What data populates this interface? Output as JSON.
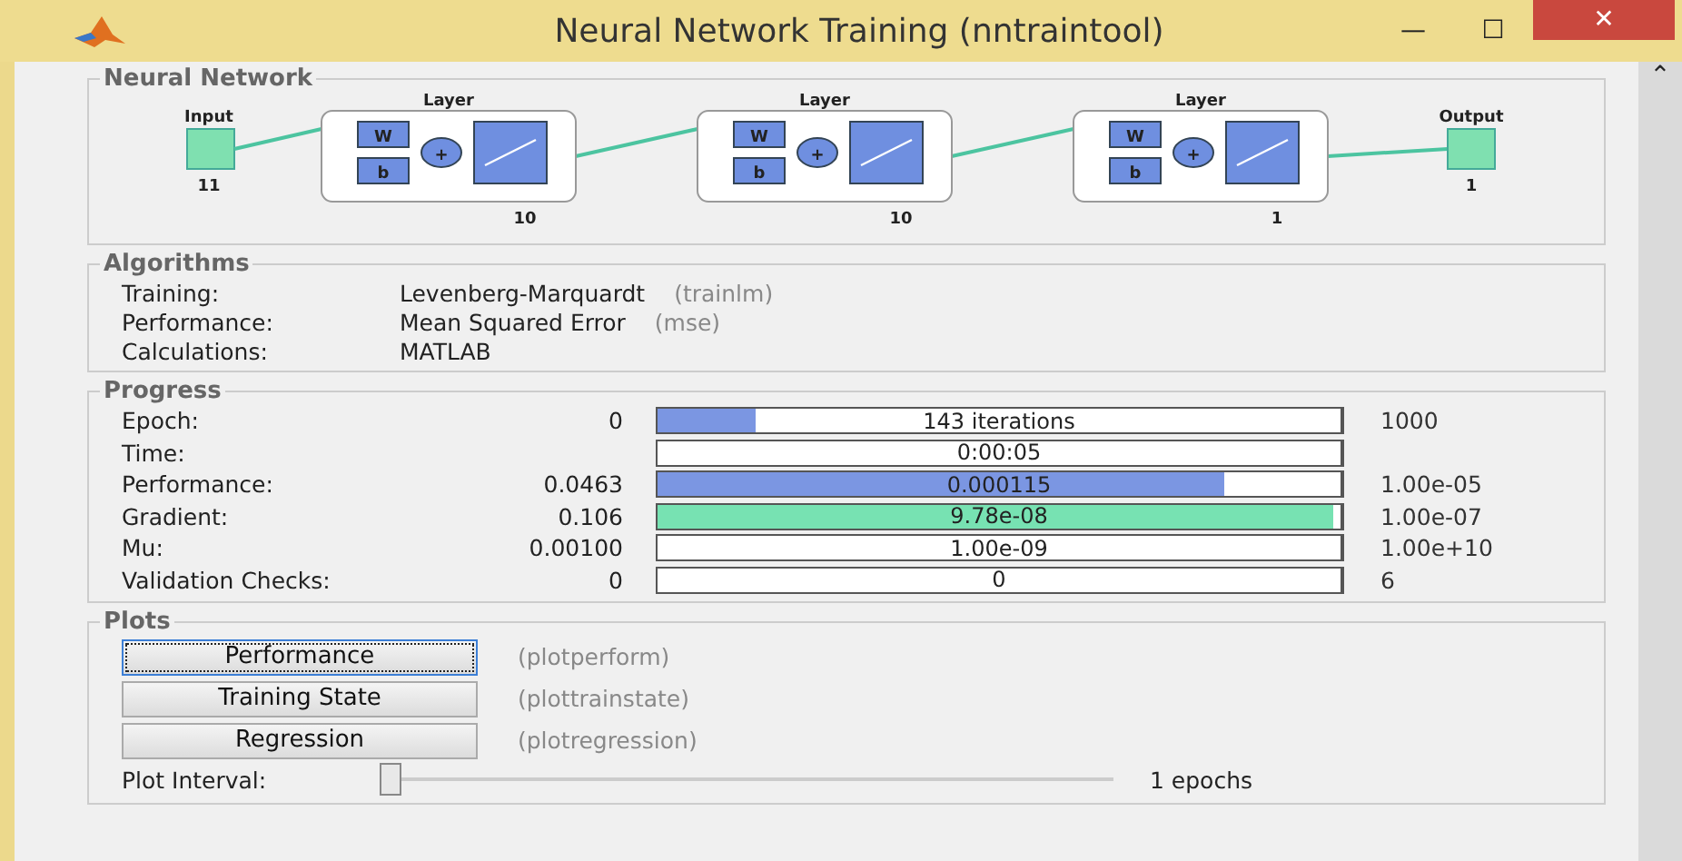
{
  "window": {
    "title": "Neural Network Training (nntraintool)",
    "minimize": "—",
    "maximize": "☐",
    "close": "✕"
  },
  "network": {
    "title": "Neural Network",
    "input": {
      "label": "Input",
      "size": "11"
    },
    "output": {
      "label": "Output",
      "size": "1"
    },
    "layers": [
      {
        "label": "Layer",
        "size": "10",
        "w": "W",
        "b": "b",
        "sum": "+"
      },
      {
        "label": "Layer",
        "size": "10",
        "w": "W",
        "b": "b",
        "sum": "+"
      },
      {
        "label": "Layer",
        "size": "1",
        "w": "W",
        "b": "b",
        "sum": "+"
      }
    ]
  },
  "algorithms": {
    "title": "Algorithms",
    "rows": [
      {
        "label": "Training:",
        "value": "Levenberg-Marquardt",
        "function": "(trainlm)"
      },
      {
        "label": "Performance:",
        "value": "Mean Squared Error",
        "function": "(mse)"
      },
      {
        "label": "Calculations:",
        "value": "MATLAB"
      }
    ]
  },
  "progress": {
    "title": "Progress",
    "rows": [
      {
        "label": "Epoch:",
        "start": "0",
        "bar_text": "143 iterations",
        "level": 0.143,
        "color": "#7b96e2",
        "end": "1000"
      },
      {
        "label": "Time:",
        "bar_text": "0:00:05"
      },
      {
        "label": "Performance:",
        "start": "0.0463",
        "bar_text": "0.000115",
        "level": 0.83,
        "color": "#7b96e2",
        "end": "1.00e-05"
      },
      {
        "label": "Gradient:",
        "start": "0.106",
        "bar_text": "9.78e-08",
        "level": 0.99,
        "color": "#77e2b2",
        "end": "1.00e-07"
      },
      {
        "label": "Mu:",
        "start": "0.00100",
        "bar_text": "1.00e-09",
        "end": "1.00e+10"
      },
      {
        "label": "Validation Checks:",
        "start": "0",
        "bar_text": "0",
        "end": "6"
      }
    ]
  },
  "plots": {
    "title": "Plots",
    "buttons": [
      {
        "label": "Performance",
        "function": "(plotperform)",
        "focused": true
      },
      {
        "label": "Training State",
        "function": "(plottrainstate)",
        "focused": false
      },
      {
        "label": "Regression",
        "function": "(plotregression)",
        "focused": false
      }
    ],
    "interval": {
      "label": "Plot Interval:",
      "level": 0,
      "value": "1 epochs"
    }
  },
  "scrollbar": {
    "up": "⌃"
  }
}
